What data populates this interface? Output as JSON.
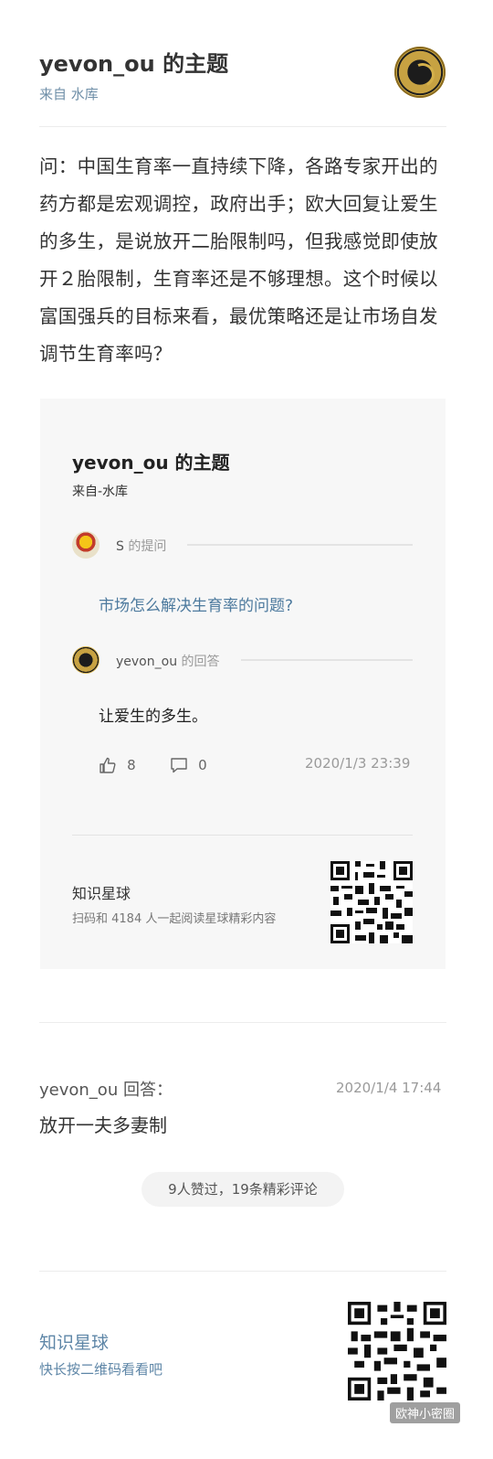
{
  "header": {
    "title": "yevon_ou 的主题",
    "source": "来自 水库"
  },
  "question": "问：中国生育率一直持续下降，各路专家开出的药方都是宏观调控，政府出手；欧大回复让爱生的多生，是说放开二胎限制吗，但我感觉即使放开２胎限制，生育率还是不够理想。这个时候以富国强兵的目标来看，最优策略还是让市场自发调节生育率吗？",
  "card": {
    "title": "yevon_ou 的主题",
    "source": "来自-水库",
    "asker_name": "S",
    "asker_suffix": "的提问",
    "question_text": "市场怎么解决生育率的问题?",
    "answerer_name": "yevon_ou",
    "answerer_suffix": "的回答",
    "answer_text": "让爱生的多生。",
    "likes": "8",
    "comments": "0",
    "date": "2020/1/3 23:39",
    "planet_label": "知识星球",
    "scan_text": "扫码和 4184 人一起阅读星球精彩内容"
  },
  "reply": {
    "label": "yevon_ou 回答：",
    "date": "2020/1/4 17:44",
    "text": "放开一夫多妻制"
  },
  "summary_pill": "9人赞过，19条精彩评论",
  "footer": {
    "title": "知识星球",
    "subtitle": "快长按二维码看看吧"
  },
  "watermark": "欧神小密圈",
  "icons": {
    "like": "thumbs-up-icon",
    "comment": "comment-icon",
    "qr": "qr-code-icon"
  },
  "colors": {
    "link_blue": "#5e86a7",
    "question_blue": "#4d7a9e",
    "card_bg": "#f7f7f7"
  }
}
